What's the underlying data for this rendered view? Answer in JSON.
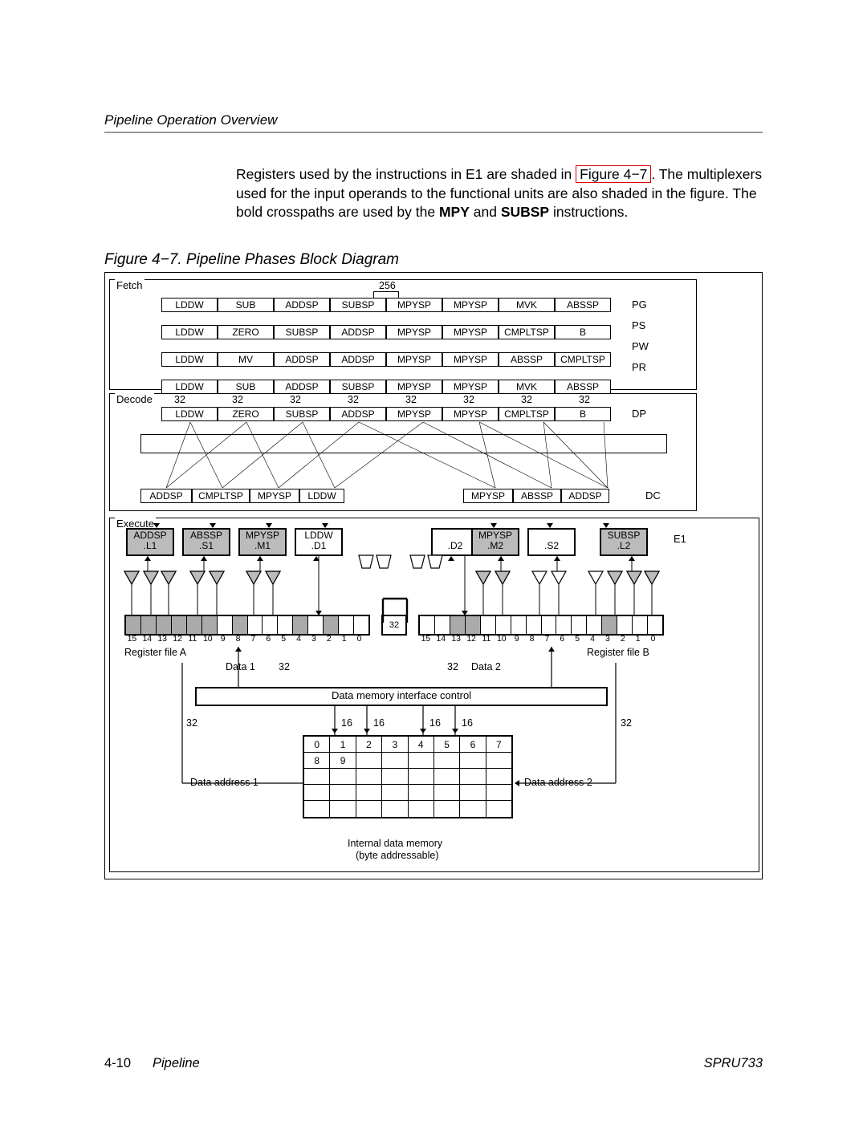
{
  "header": "Pipeline Operation Overview",
  "paragraph": {
    "p1a": "Registers used by the instructions in E1 are shaded in ",
    "linkText": "Figure 4−7",
    "p1b": ". The multiplexers used for the input operands to the functional units are also shaded in the figure. The bold crosspaths are used by the ",
    "bold1": "MPY",
    "mid": " and ",
    "bold2": "SUBSP",
    "p1c": " instructions."
  },
  "caption": "Figure 4−7. Pipeline Phases Block Diagram",
  "section": {
    "fetch": "Fetch",
    "decode": "Decode",
    "exec": "Execute"
  },
  "busWidths": {
    "b256": "256",
    "b32": "32",
    "b16": "16"
  },
  "fetchRows": [
    {
      "cells": [
        "LDDW",
        "SUB",
        "ADDSP",
        "SUBSP",
        "MPYSP",
        "MPYSP",
        "MVK",
        "ABSSP"
      ],
      "label": "PG"
    },
    {
      "cells": [
        "LDDW",
        "ZERO",
        "SUBSP",
        "ADDSP",
        "MPYSP",
        "MPYSP",
        "CMPLTSP",
        "B"
      ],
      "label": "PS"
    },
    {
      "cells": [
        "LDDW",
        "MV",
        "ADDSP",
        "ADDSP",
        "MPYSP",
        "MPYSP",
        "ABSSP",
        "CMPLTSP"
      ],
      "label": "PW"
    },
    {
      "cells": [
        "LDDW",
        "SUB",
        "ADDSP",
        "SUBSP",
        "MPYSP",
        "MPYSP",
        "MVK",
        "ABSSP"
      ],
      "label": "PR"
    }
  ],
  "decode": {
    "dp": {
      "cells": [
        "LDDW",
        "ZERO",
        "SUBSP",
        "ADDSP",
        "MPYSP",
        "MPYSP",
        "CMPLTSP",
        "B"
      ],
      "label": "DP"
    },
    "dc": {
      "cells": [
        "ADDSP",
        "CMPLTSP",
        "MPYSP",
        "LDDW",
        "",
        "MPYSP",
        "ABSSP",
        "ADDSP"
      ],
      "label": "DC"
    }
  },
  "fu": [
    {
      "t": "ADDSP",
      "s": ".L1",
      "shaded": true
    },
    {
      "t": "ABSSP",
      "s": ".S1",
      "shaded": true
    },
    {
      "t": "MPYSP",
      "s": ".M1",
      "shaded": true
    },
    {
      "t": "LDDW",
      "s": ".D1",
      "shaded": false
    },
    {
      "t": "",
      "s": ".D2",
      "shaded": false
    },
    {
      "t": "MPYSP",
      "s": ".M2",
      "shaded": true
    },
    {
      "t": "",
      "s": ".S2",
      "shaded": false
    },
    {
      "t": "SUBSP",
      "s": ".L2",
      "shaded": true
    }
  ],
  "e1": "E1",
  "regA": "Register file A",
  "regB": "Register file B",
  "data1": "Data 1",
  "data2": "Data 2",
  "dmic": "Data memory interface control",
  "addr1": "Data address 1",
  "addr2": "Data address 2",
  "imem1": "Internal data memory",
  "imem2": "(byte addressable)",
  "regNums": [
    "15",
    "14",
    "13",
    "12",
    "11",
    "10",
    "9",
    "8",
    "7",
    "6",
    "5",
    "4",
    "3",
    "2",
    "1",
    "0"
  ],
  "regAShaded": [
    15,
    14,
    13,
    12,
    11,
    10,
    8,
    4,
    2
  ],
  "regBShaded": [
    13,
    12,
    3
  ],
  "dmemTop": [
    "0",
    "1",
    "2",
    "3",
    "4",
    "5",
    "6",
    "7"
  ],
  "dmemMid": [
    "8",
    "9"
  ],
  "footer": {
    "page": "4-10",
    "title": "Pipeline",
    "id": "SPRU733"
  }
}
